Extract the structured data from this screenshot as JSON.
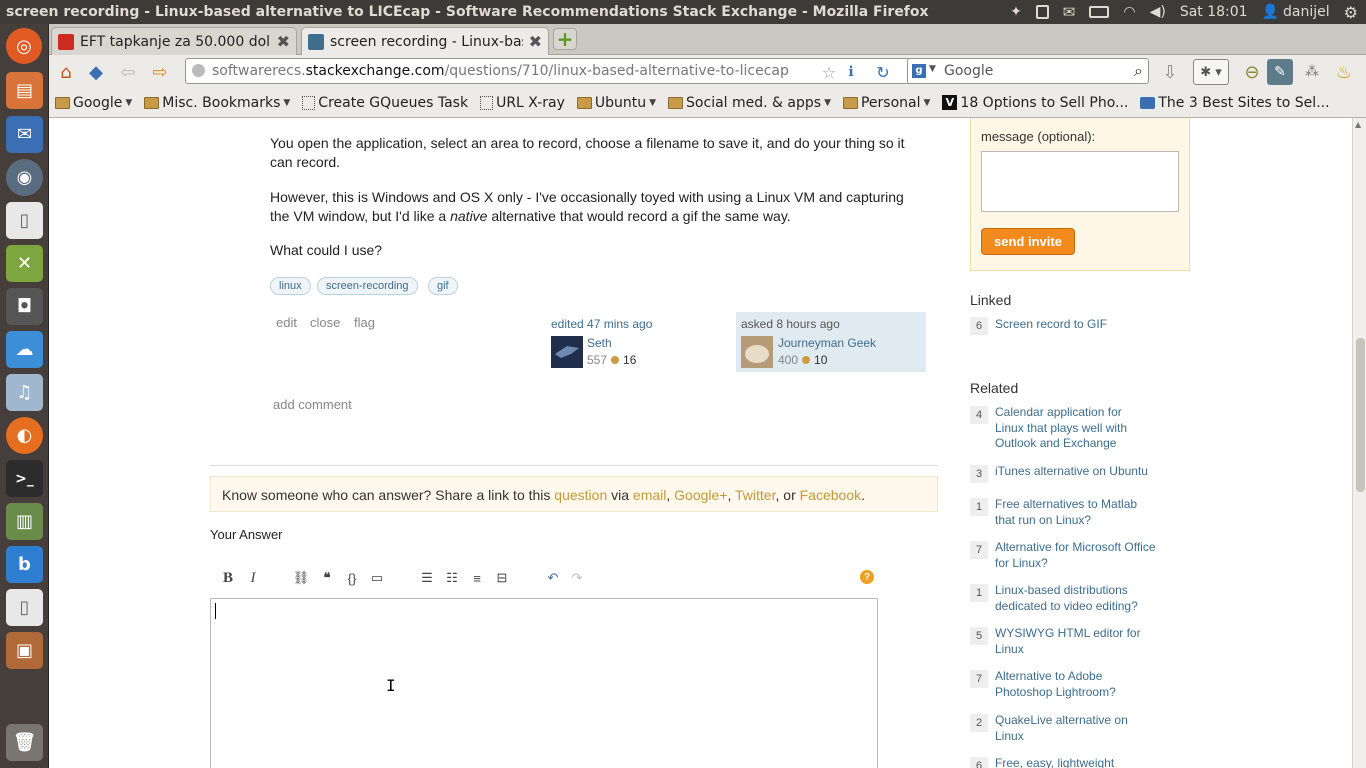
{
  "window": {
    "title": "screen recording - Linux-based alternative to LICEcap - Software Recommendations Stack Exchange - Mozilla Firefox",
    "clock": "Sat 18:01",
    "user": "danijel"
  },
  "tabs": [
    {
      "label": "EFT tapkanje za 50.000 dola..."
    },
    {
      "label": "screen recording - Linux-bas..."
    }
  ],
  "nav": {
    "url_host_pre": "softwarerecs.",
    "url_host": "stackexchange.com",
    "url_path": "/questions/710/linux-based-alternative-to-licecap",
    "search_engine": "Google",
    "search_placeholder": "Google"
  },
  "bookmarks": [
    {
      "label": "Google",
      "type": "folder"
    },
    {
      "label": "Misc. Bookmarks",
      "type": "folder"
    },
    {
      "label": "Create GQueues Task",
      "type": "page"
    },
    {
      "label": "URL X-ray",
      "type": "page"
    },
    {
      "label": "Ubuntu",
      "type": "folder"
    },
    {
      "label": "Social med. & apps",
      "type": "folder"
    },
    {
      "label": "Personal",
      "type": "folder"
    },
    {
      "label": "18 Options to Sell Pho...",
      "type": "site"
    },
    {
      "label": "The 3 Best Sites to Sel...",
      "type": "site"
    }
  ],
  "question": {
    "p1": "You open the application, select an area to record, choose a filename to save it, and do your thing so it",
    "p1b": "can record.",
    "p2a": "However, this is Windows and OS X only - I've occasionally toyed with using a Linux VM and capturing",
    "p2b_pre": "the VM window, but I'd like a ",
    "p2b_em": "native",
    "p2b_post": " alternative that would record a gif the same way.",
    "p3": "What could I use?",
    "tags": [
      "linux",
      "screen-recording",
      "gif"
    ],
    "actions": [
      "edit",
      "close",
      "flag"
    ],
    "edited_label": "edited 47 mins ago",
    "editor_name": "Seth",
    "editor_rep": "557",
    "editor_badges": "16",
    "asked_label": "asked 8 hours ago",
    "asker_name": "Journeyman Geek",
    "asker_rep": "400",
    "asker_badges": "10",
    "add_comment": "add comment"
  },
  "share": {
    "pre": "Know someone who can answer? Share a link to this ",
    "question": "question",
    "via": " via ",
    "email": "email",
    "comma1": ", ",
    "gplus": "Google+",
    "comma2": ", ",
    "twitter": "Twitter",
    "or": ", or ",
    "facebook": "Facebook",
    "end": "."
  },
  "answer": {
    "heading": "Your Answer",
    "help": "?"
  },
  "sidebar": {
    "message_label": "message (optional):",
    "send_invite": "send invite",
    "linked_heading": "Linked",
    "linked": [
      {
        "count": "6",
        "title": "Screen record to GIF"
      }
    ],
    "related_heading": "Related",
    "related": [
      {
        "count": "4",
        "lines": [
          "Calendar application for",
          "Linux that plays well with",
          "Outlook and Exchange"
        ]
      },
      {
        "count": "3",
        "lines": [
          "iTunes alternative on Ubuntu"
        ]
      },
      {
        "count": "1",
        "lines": [
          "Free alternatives to Matlab",
          "that run on Linux?"
        ]
      },
      {
        "count": "7",
        "lines": [
          "Alternative for Microsoft Office",
          "for Linux?"
        ]
      },
      {
        "count": "1",
        "lines": [
          "Linux-based distributions",
          "dedicated to video editing?"
        ]
      },
      {
        "count": "5",
        "lines": [
          "WYSIWYG HTML editor for",
          "Linux"
        ]
      },
      {
        "count": "7",
        "lines": [
          "Alternative to Adobe",
          "Photoshop Lightroom?"
        ]
      },
      {
        "count": "2",
        "lines": [
          "QuakeLive alternative on",
          "Linux"
        ]
      },
      {
        "count": "6",
        "lines": [
          "Free, easy, lightweight"
        ]
      }
    ]
  },
  "colors": {
    "accent": "#f38a1e",
    "link": "#3e6d8e",
    "orange_link": "#c49a3a"
  }
}
